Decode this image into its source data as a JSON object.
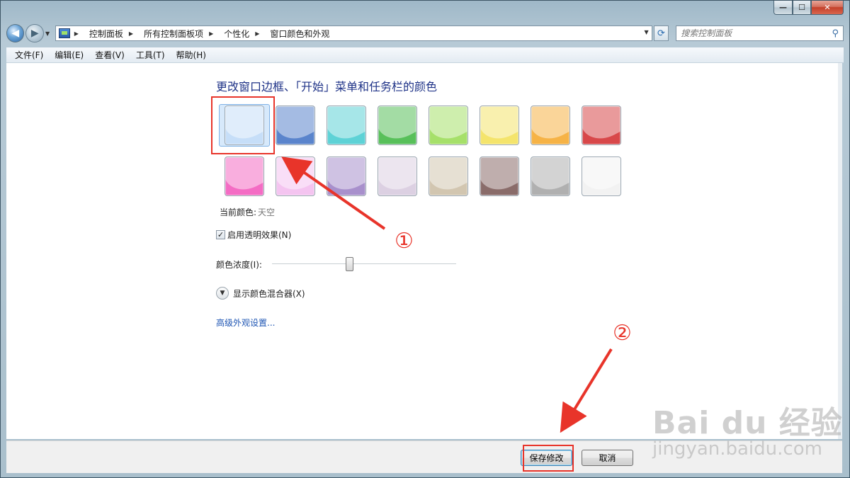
{
  "window": {
    "caption_buttons": {
      "minimize": "—",
      "maximize": "☐",
      "close": "✕"
    }
  },
  "nav": {
    "back_icon": "arrow-left-icon",
    "forward_icon": "arrow-right-icon",
    "breadcrumbs": [
      "控制面板",
      "所有控制面板项",
      "个性化",
      "窗口颜色和外观"
    ],
    "search_placeholder": "搜索控制面板"
  },
  "menu": [
    "文件(F)",
    "编辑(E)",
    "查看(V)",
    "工具(T)",
    "帮助(H)"
  ],
  "main": {
    "title": "更改窗口边框、「开始」菜单和任务栏的颜色",
    "swatches": [
      [
        "#c6def8",
        "#5a84cc",
        "#5ed2d6",
        "#58c05a",
        "#a6e06a",
        "#f4e46c",
        "#f6b346",
        "#d8484a"
      ],
      [
        "#f46cc4",
        "#f4c4f0",
        "#a890cc",
        "#dcd0e2",
        "#d2c6b0",
        "#8a6c6a",
        "#b0b0b0",
        "#f2f2f2"
      ]
    ],
    "selected_swatch": 0,
    "current_color_label": "当前颜色:",
    "current_color_value": "天空",
    "transparency_label": "启用透明效果(N)",
    "transparency_checked": true,
    "intensity_label": "颜色浓度(I):",
    "intensity_value": 0.42,
    "mixer_label": "显示颜色混合器(X)",
    "advanced_link": "高级外观设置..."
  },
  "annotations": {
    "step1": "①",
    "step2": "②",
    "color": "#e8342a"
  },
  "buttons": {
    "save": "保存修改",
    "cancel": "取消"
  },
  "watermark": {
    "main": "Bai du 经验",
    "sub": "jingyan.baidu.com"
  }
}
